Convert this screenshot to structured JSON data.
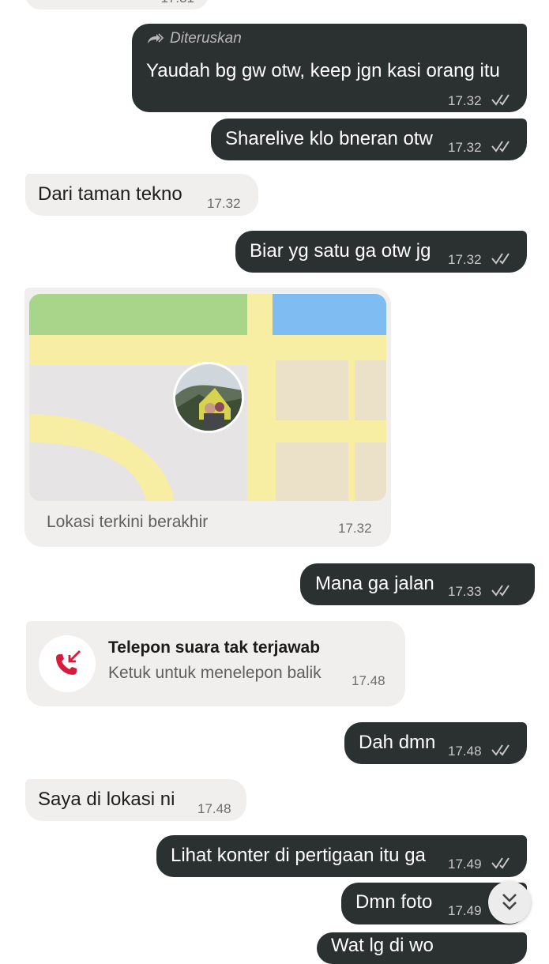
{
  "top_partial": {
    "time": "17.31"
  },
  "messages": {
    "m1": {
      "forwarded_label": "Diteruskan",
      "text": "Yaudah bg gw otw, keep jgn kasi orang itu",
      "time": "17.32"
    },
    "m2": {
      "text": "Sharelive klo bneran otw",
      "time": "17.32"
    },
    "m3": {
      "text": "Dari taman tekno",
      "time": "17.32"
    },
    "m4": {
      "text": "Biar yg satu ga otw jg",
      "time": "17.32"
    },
    "m5": {
      "caption": "Lokasi terkini berakhir",
      "time": "17.32"
    },
    "m6": {
      "text": "Mana ga jalan",
      "time": "17.33"
    },
    "m7": {
      "title": "Telepon suara tak terjawab",
      "subtitle": "Ketuk untuk menelepon balik",
      "time": "17.48"
    },
    "m8": {
      "text": "Dah dmn",
      "time": "17.48"
    },
    "m9": {
      "text": "Saya di lokasi ni",
      "time": "17.48"
    },
    "m10": {
      "text": "Lihat konter di pertigaan itu ga",
      "time": "17.49"
    },
    "m11": {
      "text": "Dmn foto",
      "time": "17.49"
    },
    "m12": {
      "text": "Wat lg di wo"
    }
  },
  "icons": {
    "read_ticks": "double-check-icon",
    "forward": "forward-icon",
    "missed_call": "missed-call-icon",
    "scroll_down": "chevron-double-down-icon"
  },
  "colors": {
    "outgoing_bubble": "#2b3031",
    "incoming_bubble": "#f1eeee",
    "missed_call_red": "#d81b3c",
    "map_green": "#a9d58a",
    "map_blue": "#7fbcf2",
    "map_road": "#f7eea3"
  }
}
